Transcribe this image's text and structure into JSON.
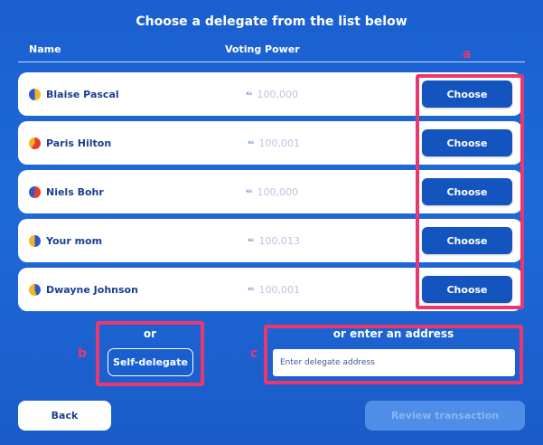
{
  "header": {
    "title": "Choose a delegate from the list below",
    "col_name": "Name",
    "col_power": "Voting Power"
  },
  "delegates": [
    {
      "name": "Blaise Pascal",
      "power": "100,000",
      "avatar_color": "#f2b61e",
      "avatar_color2": "#2c58c9"
    },
    {
      "name": "Paris Hilton",
      "power": "100,001",
      "avatar_color": "#e63b2e",
      "avatar_color2": "#f2b61e"
    },
    {
      "name": "Niels Bohr",
      "power": "100,000",
      "avatar_color": "#e63b2e",
      "avatar_color2": "#2c58c9"
    },
    {
      "name": "Your mom",
      "power": "100,013",
      "avatar_color": "#2c58c9",
      "avatar_color2": "#f2b61e"
    },
    {
      "name": "Dwayne Johnson",
      "power": "100,001",
      "avatar_color": "#2c58c9",
      "avatar_color2": "#f2b61e"
    }
  ],
  "choose_label": "Choose",
  "power_icon": "voting-power-icon",
  "markers": {
    "a": "a",
    "b": "b",
    "c": "c"
  },
  "self_delegate": {
    "or_label": "or",
    "button_label": "Self-delegate"
  },
  "address": {
    "label": "or enter an address",
    "placeholder": "Enter delegate address",
    "value": ""
  },
  "footer": {
    "back_label": "Back",
    "review_label": "Review transaction"
  },
  "colors": {
    "highlight": "#e8386e",
    "primary": "#1454bf",
    "background": "#1a5fd0"
  }
}
